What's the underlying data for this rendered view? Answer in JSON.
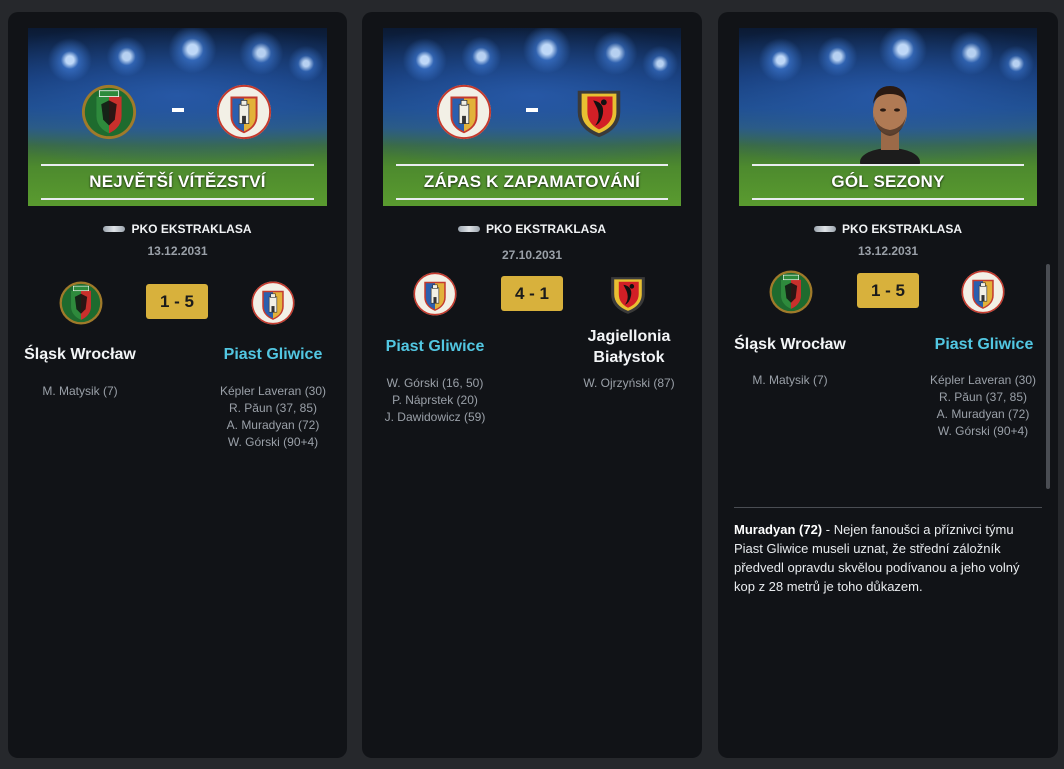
{
  "cards": [
    {
      "banner_title": "NEJVĚTŠÍ VÍTĚZSTVÍ",
      "league": "PKO EKSTRAKLASA",
      "date": "13.12.2031",
      "score": "1 - 5",
      "home": {
        "name": "Śląsk Wrocław",
        "scorers": [
          "M. Matysik (7)"
        ]
      },
      "away": {
        "name": "Piast Gliwice",
        "scorers": [
          "Képler Laveran (30)",
          "R. Păun (37, 85)",
          "A. Muradyan (72)",
          "W. Górski (90+4)"
        ]
      }
    },
    {
      "banner_title": "ZÁPAS K ZAPAMATOVÁNÍ",
      "league": "PKO EKSTRAKLASA",
      "date": "27.10.2031",
      "score": "4 - 1",
      "home": {
        "name": "Piast Gliwice",
        "scorers": [
          "W. Górski (16, 50)",
          "P. Náprstek (20)",
          "J. Dawidowicz (59)"
        ]
      },
      "away": {
        "name_line1": "Jagiellonia",
        "name_line2": "Białystok",
        "scorers": [
          "W. Ojrzyński (87)"
        ]
      }
    },
    {
      "banner_title": "GÓL SEZONY",
      "league": "PKO EKSTRAKLASA",
      "date": "13.12.2031",
      "score": "1 - 5",
      "home": {
        "name": "Śląsk Wrocław",
        "scorers": [
          "M. Matysik (7)"
        ]
      },
      "away": {
        "name": "Piast Gliwice",
        "scorers": [
          "Képler Laveran (30)",
          "R. Păun (37, 85)",
          "A. Muradyan (72)",
          "W. Górski (90+4)"
        ]
      },
      "story_lead": "Muradyan (72)",
      "story_text": " - Nejen fanoušci a příznivci týmu Piast Gliwice museli uznat, že střední záložník předvedl opravdu skvělou podívanou a jeho volný kop z 28 metrů je toho důkazem."
    }
  ],
  "colors": {
    "background": "#26282c",
    "card": "#111317",
    "score_badge": "#d8b13c",
    "highlight_team": "#52c7e2"
  },
  "icons": [
    "slask-wroclaw-crest-icon",
    "piast-gliwice-crest-icon",
    "jagiellonia-bialystok-crest-icon",
    "league-logo-icon",
    "player-portrait"
  ]
}
